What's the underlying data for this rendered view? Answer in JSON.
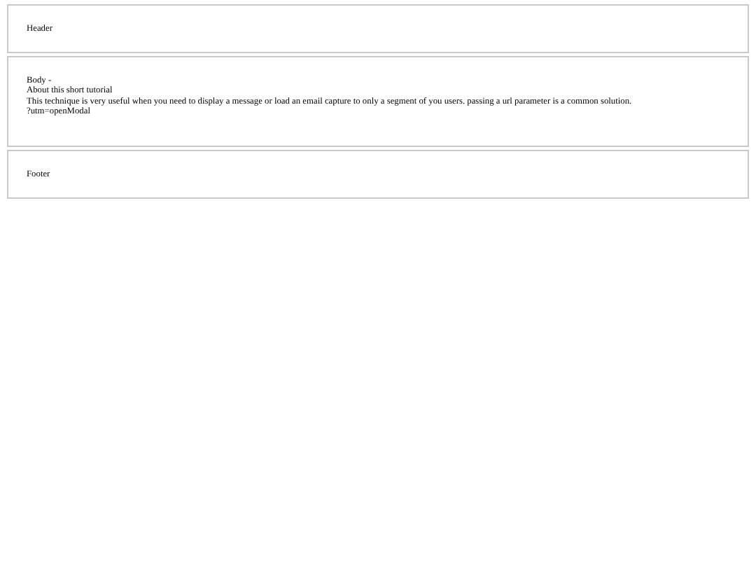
{
  "header": {
    "text": "Header"
  },
  "body": {
    "lines": [
      "Body -",
      "About this short tutorial",
      "This technique is very useful when you need to display a message or load an email capture to only a segment of you users. passing a url parameter is a common solution.",
      "?utm=openModal"
    ]
  },
  "footer": {
    "text": "Footer"
  }
}
